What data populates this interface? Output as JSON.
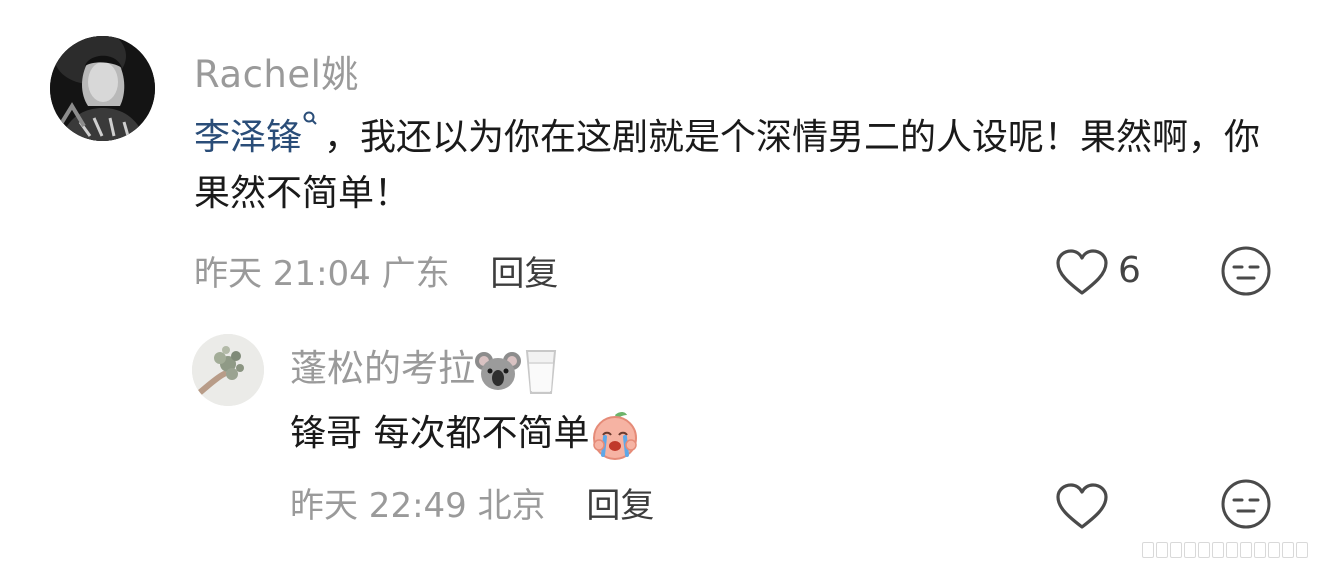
{
  "main_comment": {
    "username": "Rachel姚",
    "mention": "李泽锋",
    "body_text": "，我还以为你在这剧就是个深情男二的人设呢！果然啊，你果然不简单！",
    "time": "昨天 21:04",
    "location": "广东",
    "reply_label": "回复",
    "like_count": "6"
  },
  "reply_comment": {
    "username": "蓬松的考拉",
    "username_emojis": [
      "koala-emoji",
      "milk-glass-emoji"
    ],
    "body_text": "锋哥 每次都不简单",
    "body_emoji": "crying-peach-emoji",
    "time": "昨天 22:49",
    "location": "北京",
    "reply_label": "回复"
  },
  "colors": {
    "muted_text": "#9a9a9a",
    "body_text": "#1a1a1a",
    "mention_link": "#2a4d78",
    "icon_stroke": "#4a4a4a"
  },
  "icons": {
    "like": "heart-outline-icon",
    "reaction": "neutral-face-icon",
    "mention": "search-loop-icon"
  }
}
